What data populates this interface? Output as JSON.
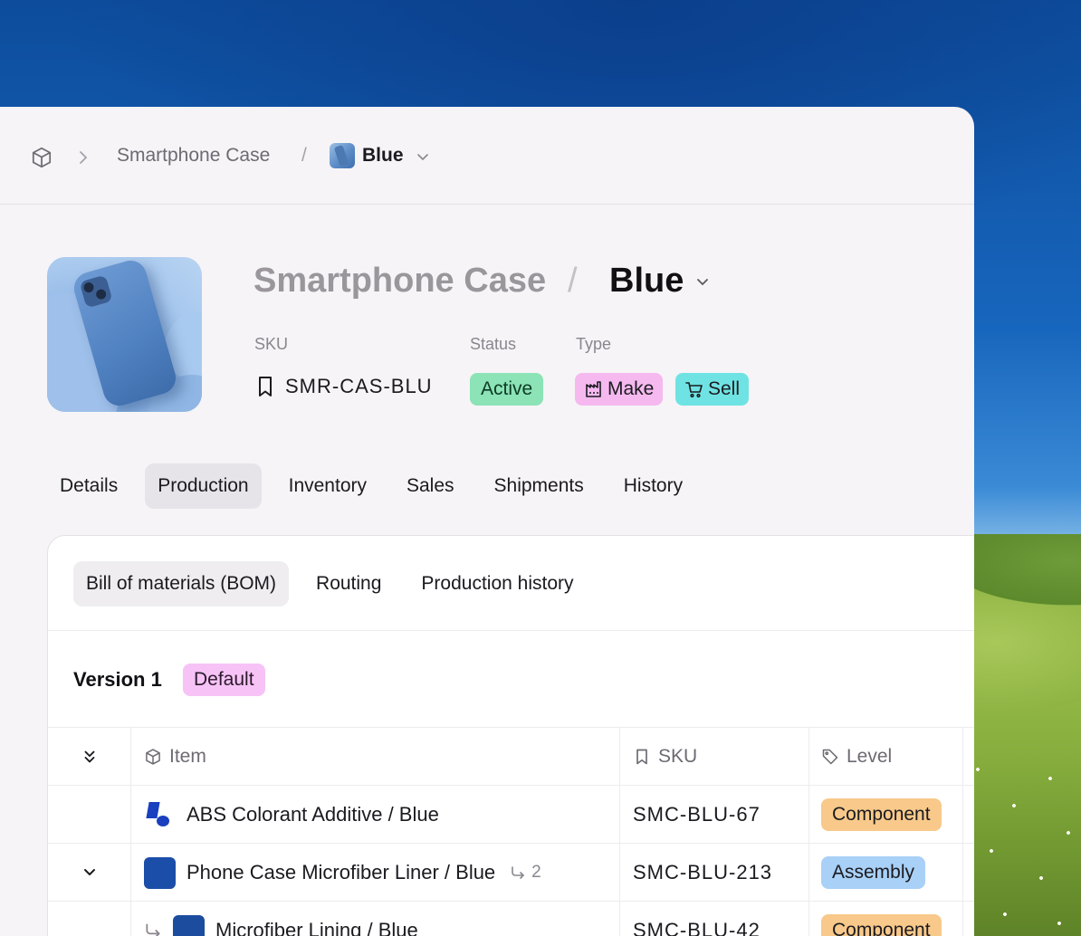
{
  "breadcrumb": {
    "parent": "Smartphone Case",
    "separator": "/",
    "current": "Blue"
  },
  "header": {
    "title_parent": "Smartphone Case",
    "title_separator": "/",
    "title_current": "Blue",
    "sku_label": "SKU",
    "sku_value": "SMR-CAS-BLU",
    "status_label": "Status",
    "status_value": "Active",
    "type_label": "Type",
    "type_badges": [
      "Make",
      "Sell"
    ]
  },
  "tabs": [
    {
      "label": "Details"
    },
    {
      "label": "Production",
      "selected": true
    },
    {
      "label": "Inventory"
    },
    {
      "label": "Sales"
    },
    {
      "label": "Shipments"
    },
    {
      "label": "History"
    }
  ],
  "subtabs": [
    {
      "label": "Bill of materials (BOM)",
      "selected": true
    },
    {
      "label": "Routing"
    },
    {
      "label": "Production history"
    }
  ],
  "version": {
    "title": "Version 1",
    "badge": "Default"
  },
  "table": {
    "headers": {
      "item": "Item",
      "sku": "SKU",
      "level": "Level"
    },
    "rows": [
      {
        "item": "ABS Colorant Additive / Blue",
        "sku": "SMC-BLU-67",
        "level": "Component",
        "expandable": false
      },
      {
        "item": "Phone Case Microfiber Liner / Blue",
        "sub_count": "2",
        "sku": "SMC-BLU-213",
        "level": "Assembly",
        "expandable": true
      },
      {
        "item": "Microfiber Lining / Blue",
        "sku": "SMC-BLU-42",
        "level": "Component",
        "child": true
      }
    ]
  },
  "colors": {
    "active_badge": "#8be3b6",
    "make_badge": "#f5b9f0",
    "sell_badge": "#6fe3e3",
    "default_badge": "#f7c3f6",
    "component_badge": "#f8c98a",
    "assembly_badge": "#a9d0f7"
  }
}
